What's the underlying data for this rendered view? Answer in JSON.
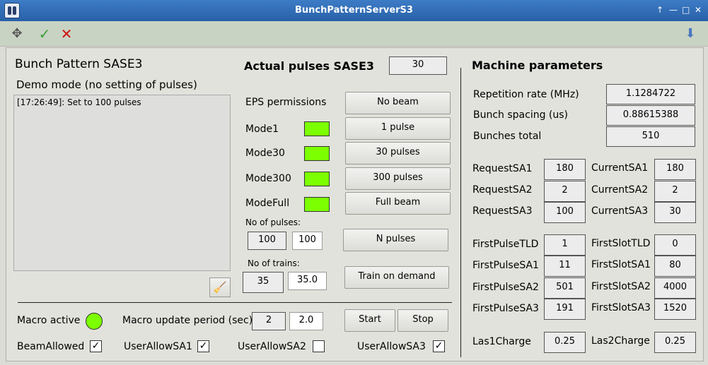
{
  "window": {
    "title": "BunchPatternServerS3"
  },
  "toolbar": {
    "move_icon": "move-icon",
    "apply_icon": "check-icon",
    "cancel_icon": "cross-icon",
    "download_icon": "download-arrow-icon"
  },
  "left": {
    "title": "Bunch Pattern SASE3",
    "mode": "Demo mode (no setting of pulses)",
    "log": "[17:26:49]: Set to 100 pulses"
  },
  "pulses": {
    "title": "Actual pulses SASE3",
    "actual": "30",
    "eps_label": "EPS permissions",
    "no_beam": "No beam",
    "modes": [
      {
        "label": "Mode1",
        "button": "1 pulse"
      },
      {
        "label": "Mode30",
        "button": "30 pulses"
      },
      {
        "label": "Mode300",
        "button": "300 pulses"
      },
      {
        "label": "ModeFull",
        "button": "Full beam"
      }
    ],
    "n_pulses_label": "No of pulses:",
    "n_pulses_value": "100",
    "n_pulses_input": "100",
    "n_pulses_button": "N pulses",
    "n_trains_label": "No of trains:",
    "n_trains_value": "35",
    "n_trains_input": "35.0",
    "train_button": "Train on demand"
  },
  "macro": {
    "active_label": "Macro active",
    "period_label": "Macro update period (sec)",
    "period_value": "2",
    "period_input": "2.0",
    "start": "Start",
    "stop": "Stop"
  },
  "checks": [
    {
      "label": "BeamAllowed",
      "checked": "✓"
    },
    {
      "label": "UserAllowSA1",
      "checked": "✓"
    },
    {
      "label": "UserAllowSA2",
      "checked": ""
    },
    {
      "label": "UserAllowSA3",
      "checked": "✓"
    }
  ],
  "machine": {
    "title": "Machine parameters",
    "rep_label": "Repetition rate (MHz)",
    "rep_value": "1.1284722",
    "spacing_label": "Bunch spacing (us)",
    "spacing_value": "0.88615388",
    "total_label": "Bunches total",
    "total_value": "510",
    "rows": [
      {
        "l1": "RequestSA1",
        "v1": "180",
        "l2": "CurrentSA1",
        "v2": "180"
      },
      {
        "l1": "RequestSA2",
        "v1": "2",
        "l2": "CurrentSA2",
        "v2": "2"
      },
      {
        "l1": "RequestSA3",
        "v1": "100",
        "l2": "CurrentSA3",
        "v2": "30"
      },
      {
        "l1": "FirstPulseTLD",
        "v1": "1",
        "l2": "FirstSlotTLD",
        "v2": "0"
      },
      {
        "l1": "FirstPulseSA1",
        "v1": "11",
        "l2": "FirstSlotSA1",
        "v2": "80"
      },
      {
        "l1": "FirstPulseSA2",
        "v1": "501",
        "l2": "FirstSlotSA2",
        "v2": "4000"
      },
      {
        "l1": "FirstPulseSA3",
        "v1": "191",
        "l2": "FirstSlotSA3",
        "v2": "1520"
      },
      {
        "l1": "Las1Charge",
        "v1": "0.25",
        "l2": "Las2Charge",
        "v2": "0.25"
      }
    ]
  },
  "colors": {
    "led_on": "#7cff00",
    "titlebar": "#2f6cb6",
    "toolbar": "#c9d3c3"
  }
}
